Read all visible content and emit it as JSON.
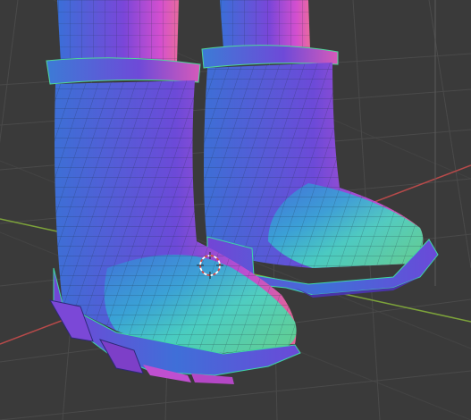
{
  "viewport": {
    "background_color": "#3a3a3a",
    "grid_color": "#4a4a4a",
    "x_axis_color": "#b84a4a",
    "y_axis_color": "#7da33a",
    "z_axis_color": "#5a5a5a",
    "wireframe_color": "#1b2d3a"
  },
  "scene": {
    "objects": [
      {
        "name": "boot-left",
        "material": "normal-map-shading"
      },
      {
        "name": "boot-right",
        "material": "normal-map-shading"
      }
    ],
    "gizmo_icon": "3d-cursor-icon",
    "material_colors": {
      "blue": "#3a6fd8",
      "violet": "#7a46d9",
      "magenta": "#d44fcf",
      "cyan": "#42d6c0",
      "green": "#4fd88e",
      "pink": "#e86a9e"
    }
  }
}
